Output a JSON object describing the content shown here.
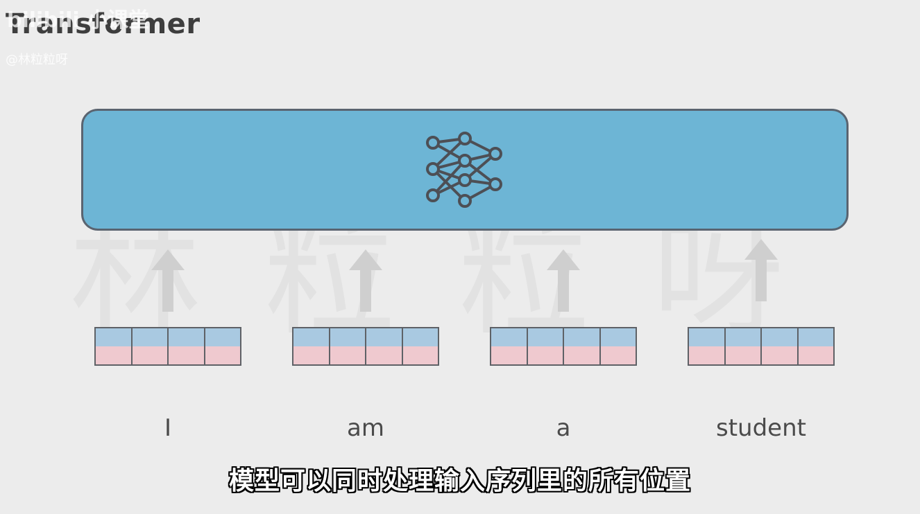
{
  "title": "Transformer",
  "watermark": {
    "logo": "bilibili 小课堂",
    "handle": "@林粒粒呀",
    "background_text": "林粒粒呀"
  },
  "model": {
    "icon": "neural-network-icon",
    "fill_color": "#6db5d5",
    "border_color": "#5a6470"
  },
  "tokens": [
    {
      "word": "I"
    },
    {
      "word": "am"
    },
    {
      "word": "a"
    },
    {
      "word": "student"
    }
  ],
  "vector_colors": {
    "top": "#a9c9e1",
    "bottom": "#efc9cf"
  },
  "arrow_color": "#cfcfcf",
  "subtitle": "模型可以同时处理输入序列里的所有位置"
}
